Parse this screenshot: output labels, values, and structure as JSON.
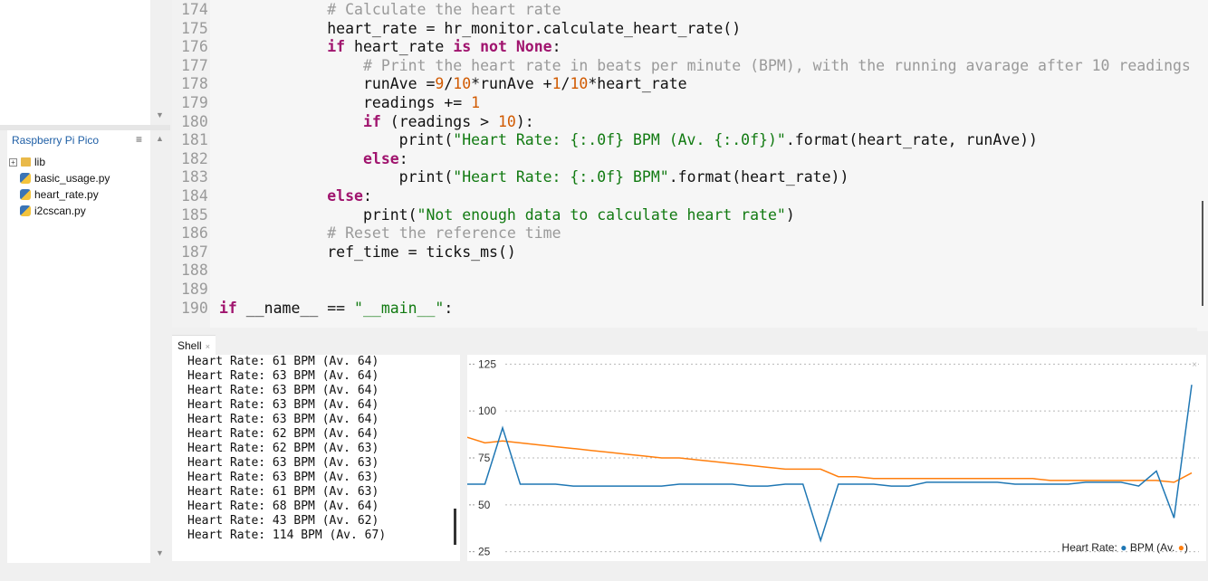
{
  "files": {
    "device_header": "Raspberry Pi Pico",
    "menu_icon": "hamburger-menu-icon",
    "items": [
      {
        "name": "lib",
        "type": "folder"
      },
      {
        "name": "basic_usage.py",
        "type": "python-file"
      },
      {
        "name": "heart_rate.py",
        "type": "python-file"
      },
      {
        "name": "i2cscan.py",
        "type": "python-file"
      }
    ]
  },
  "editor": {
    "lines": [
      {
        "n": "174",
        "segs": [
          [
            "            ",
            ""
          ],
          [
            "# Calculate the heart rate",
            "cm"
          ]
        ]
      },
      {
        "n": "175",
        "segs": [
          [
            "            heart_rate = hr_monitor.calculate_heart_rate()",
            ""
          ]
        ]
      },
      {
        "n": "176",
        "segs": [
          [
            "            ",
            ""
          ],
          [
            "if",
            "kw"
          ],
          [
            " heart_rate ",
            ""
          ],
          [
            "is not None",
            "kw"
          ],
          [
            ":",
            ""
          ]
        ]
      },
      {
        "n": "177",
        "segs": [
          [
            "                ",
            ""
          ],
          [
            "# Print the heart rate in beats per minute (BPM), with the running avarage after 10 readings",
            "cm"
          ]
        ]
      },
      {
        "n": "178",
        "segs": [
          [
            "                runAve =",
            ""
          ],
          [
            "9",
            "num"
          ],
          [
            "/",
            ""
          ],
          [
            "10",
            "num"
          ],
          [
            "*runAve +",
            ""
          ],
          [
            "1",
            "num"
          ],
          [
            "/",
            ""
          ],
          [
            "10",
            "num"
          ],
          [
            "*heart_rate",
            ""
          ]
        ]
      },
      {
        "n": "179",
        "segs": [
          [
            "                readings += ",
            ""
          ],
          [
            "1",
            "num"
          ]
        ]
      },
      {
        "n": "180",
        "segs": [
          [
            "                ",
            ""
          ],
          [
            "if",
            "kw"
          ],
          [
            " (readings > ",
            ""
          ],
          [
            "10",
            "num"
          ],
          [
            "):",
            ""
          ]
        ]
      },
      {
        "n": "181",
        "segs": [
          [
            "                    print(",
            ""
          ],
          [
            "\"Heart Rate: {:.0f} BPM (Av. {:.0f})\"",
            "str"
          ],
          [
            ".format(heart_rate, runAve))",
            ""
          ]
        ]
      },
      {
        "n": "182",
        "segs": [
          [
            "                ",
            ""
          ],
          [
            "else",
            "kw"
          ],
          [
            ":",
            ""
          ]
        ]
      },
      {
        "n": "183",
        "segs": [
          [
            "                    print(",
            ""
          ],
          [
            "\"Heart Rate: {:.0f} BPM\"",
            "str"
          ],
          [
            ".format(heart_rate))",
            ""
          ]
        ]
      },
      {
        "n": "184",
        "segs": [
          [
            "            ",
            ""
          ],
          [
            "else",
            "kw"
          ],
          [
            ":",
            ""
          ]
        ]
      },
      {
        "n": "185",
        "segs": [
          [
            "                print(",
            ""
          ],
          [
            "\"Not enough data to calculate heart rate\"",
            "str"
          ],
          [
            ")",
            ""
          ]
        ]
      },
      {
        "n": "186",
        "segs": [
          [
            "            ",
            ""
          ],
          [
            "# Reset the reference time",
            "cm"
          ]
        ]
      },
      {
        "n": "187",
        "segs": [
          [
            "            ref_time = ticks_ms()",
            ""
          ]
        ]
      },
      {
        "n": "188",
        "segs": []
      },
      {
        "n": "189",
        "segs": []
      },
      {
        "n": "190",
        "segs": [
          [
            "if",
            "kw"
          ],
          [
            " __name__ == ",
            ""
          ],
          [
            "\"__main__\"",
            "str"
          ],
          [
            ":",
            ""
          ]
        ]
      }
    ]
  },
  "shell": {
    "tab_label": "Shell",
    "output": [
      "Heart Rate: 61 BPM (Av. 64)",
      "Heart Rate: 63 BPM (Av. 64)",
      "Heart Rate: 63 BPM (Av. 64)",
      "Heart Rate: 63 BPM (Av. 64)",
      "Heart Rate: 63 BPM (Av. 64)",
      "Heart Rate: 62 BPM (Av. 64)",
      "Heart Rate: 62 BPM (Av. 63)",
      "Heart Rate: 63 BPM (Av. 63)",
      "Heart Rate: 63 BPM (Av. 63)",
      "Heart Rate: 61 BPM (Av. 63)",
      "Heart Rate: 68 BPM (Av. 64)",
      "Heart Rate: 43 BPM (Av. 62)",
      "Heart Rate: 114 BPM (Av. 67)"
    ]
  },
  "chart_data": {
    "type": "line",
    "ylim": [
      20,
      130
    ],
    "yticks": [
      25,
      50,
      75,
      100,
      125
    ],
    "grid": true,
    "legend_placement": "bottom-right",
    "legend_text": {
      "label": "Heart Rate:",
      "bpm": "BPM (Av.",
      "close": ")"
    },
    "series": [
      {
        "name": "BPM",
        "color": "#1f77b4",
        "values": [
          61,
          61,
          91,
          61,
          61,
          61,
          60,
          60,
          60,
          60,
          60,
          60,
          61,
          61,
          61,
          61,
          60,
          60,
          61,
          61,
          31,
          61,
          61,
          61,
          60,
          60,
          62,
          62,
          62,
          62,
          62,
          61,
          61,
          61,
          61,
          62,
          62,
          62,
          60,
          68,
          43,
          114
        ]
      },
      {
        "name": "Av.",
        "color": "#ff7f0e",
        "values": [
          86,
          83,
          84,
          83,
          82,
          81,
          80,
          79,
          78,
          77,
          76,
          75,
          75,
          74,
          73,
          72,
          71,
          70,
          69,
          69,
          69,
          65,
          65,
          64,
          64,
          64,
          64,
          64,
          64,
          64,
          64,
          64,
          64,
          63,
          63,
          63,
          63,
          63,
          63,
          63,
          62,
          67
        ]
      }
    ]
  }
}
